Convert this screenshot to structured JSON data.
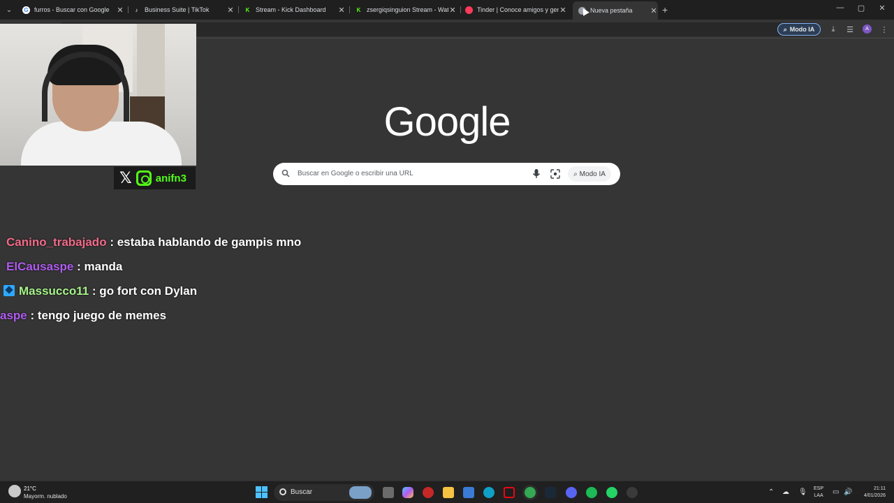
{
  "browser": {
    "tabs": [
      {
        "label": "furros - Buscar con Google",
        "icon": "google-g-icon"
      },
      {
        "label": "Business Suite | TikTok",
        "icon": "tiktok-icon"
      },
      {
        "label": "Stream - Kick Dashboard",
        "icon": "kick-icon"
      },
      {
        "label": "zsergiqsinguion Stream - Watch",
        "icon": "kick-icon"
      },
      {
        "label": "Tinder | Conoce amigos y gent",
        "icon": "tinder-icon"
      },
      {
        "label": "Nueva pestaña",
        "icon": "chrome-icon",
        "active": true
      }
    ],
    "toolbar": {
      "modo_ia_label": "Modo IA",
      "profile_initial": "A"
    }
  },
  "newtab": {
    "logo": "Google",
    "search_placeholder": "Buscar en Google o escribir una URL",
    "modo_ia_label": "Modo IA"
  },
  "overlay": {
    "social_handle": "anifn3",
    "chat": [
      {
        "user": "Canino_trabajado",
        "message": ": estaba hablando de gampis mno",
        "color": "#f26b8a"
      },
      {
        "user": "ElCausaspe",
        "message": ": manda",
        "color": "#b05cf0"
      },
      {
        "user": "Massucco11",
        "message": ": go fort con Dylan",
        "color": "#a6f28a",
        "badge": true
      },
      {
        "user": "aspe",
        "message": ": tengo juego de memes",
        "color": "#b05cf0"
      }
    ]
  },
  "taskbar": {
    "weather_temp": "21°C",
    "weather_desc": "Mayorm. nublado",
    "search_label": "Buscar",
    "lang_line1": "ESP",
    "lang_line2": "LAA",
    "time": "21:11",
    "date": "4/01/2026"
  }
}
